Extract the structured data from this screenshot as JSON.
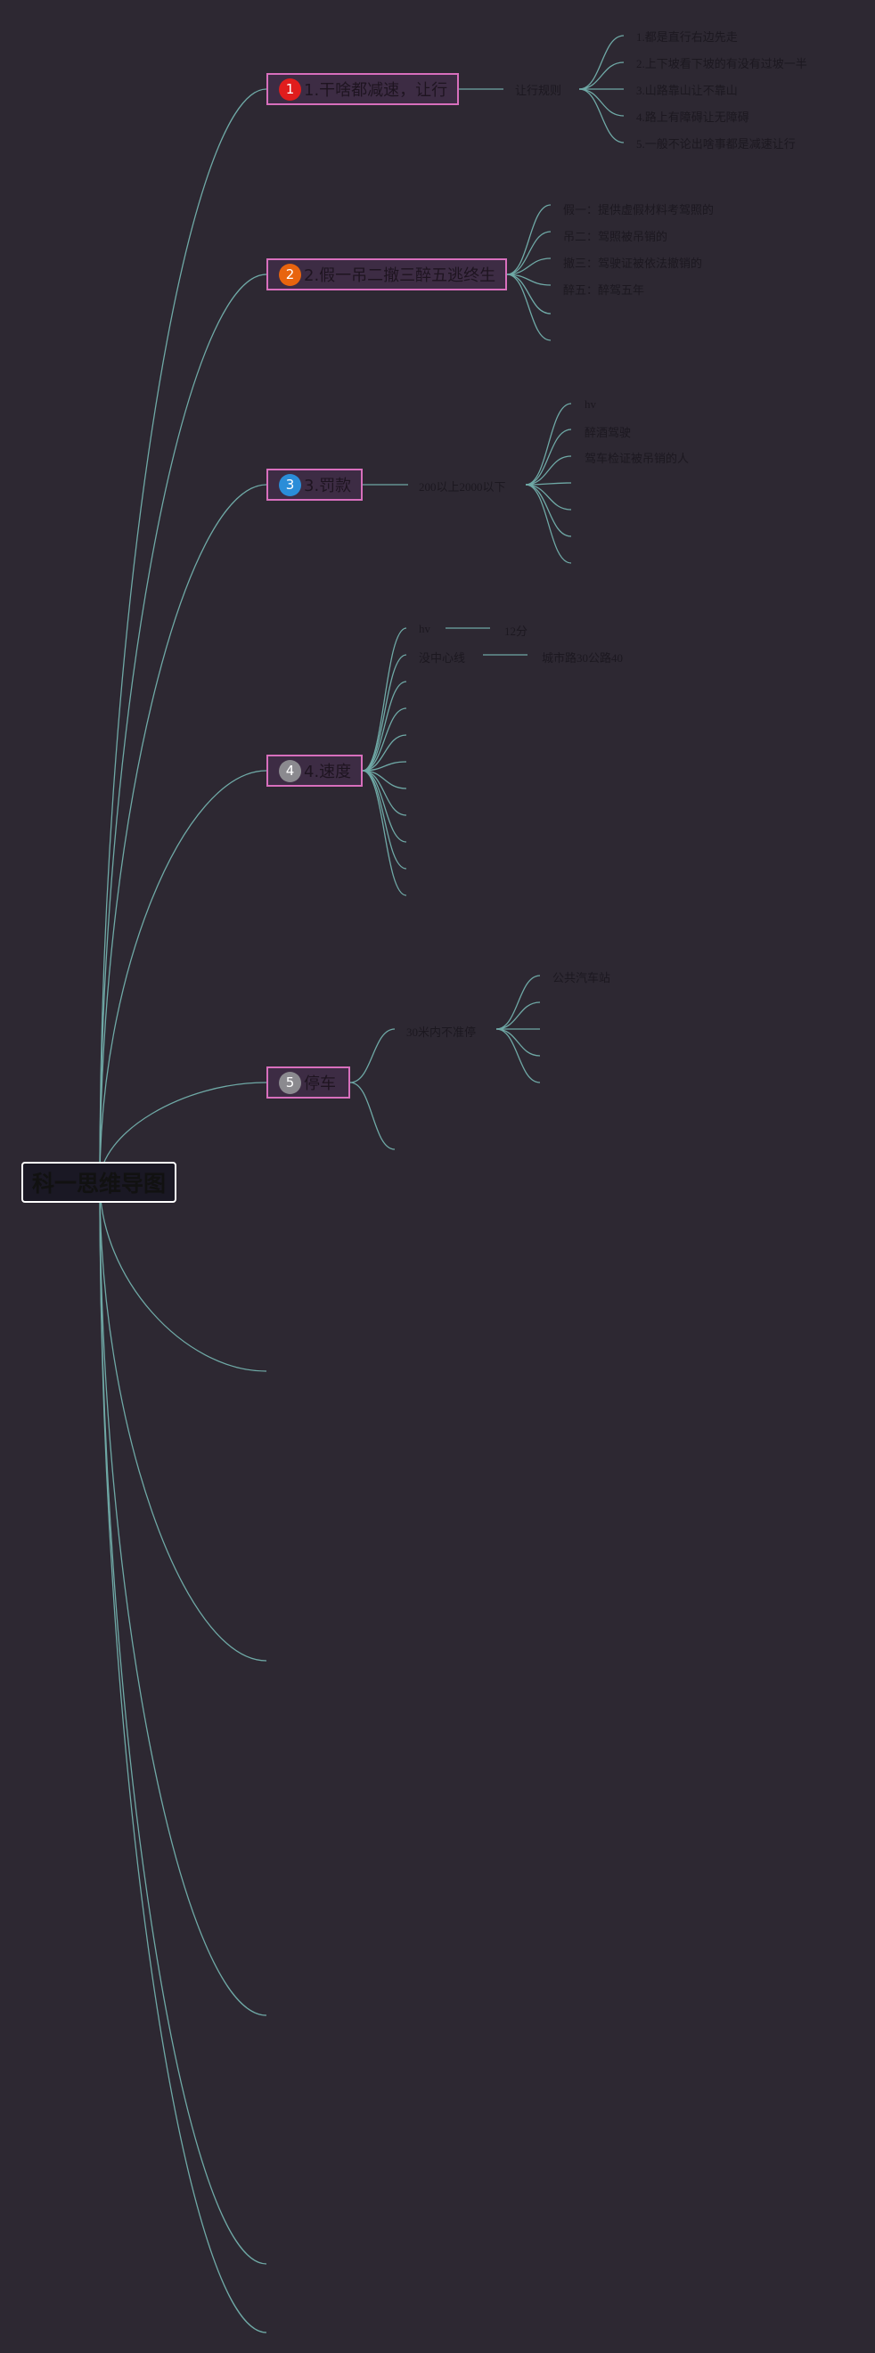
{
  "root": {
    "title": "科一思维导图"
  },
  "colors": {
    "background": "#2d2832",
    "link": "#6fa9a6",
    "branch_border": "#d86fbd",
    "badge_1": "#e01d1d",
    "badge_2": "#e8640e",
    "badge_3": "#2a8dd8",
    "badge_4": "#8b8a8f",
    "badge_5": "#8b8a8f"
  },
  "branches": [
    {
      "badge": "1",
      "label": "1.干啥都减速，让行",
      "sub": "让行规则",
      "leaves": [
        "1.都是直行右边先走",
        "2.上下坡看下坡的有没有过坡一半",
        "3.山路靠山让不靠山",
        "4.路上有障碍让无障碍",
        "5.一般不论出啥事都是减速让行"
      ]
    },
    {
      "badge": "2",
      "label": "2.假一吊二撤三醉五逃终生",
      "leaves": [
        "假一：提供虚假材料考驾照的",
        "吊二：驾照被吊销的",
        "撤三：驾驶证被依法撤销的",
        "醉五：醉驾五年"
      ]
    },
    {
      "badge": "3",
      "label": "3.罚款",
      "sub": "200以上2000以下",
      "leaves": [
        "hv",
        "醉酒驾驶",
        "驾车检证被吊销的人"
      ]
    },
    {
      "badge": "4",
      "label": "4.速度",
      "rows": [
        {
          "key": "hv",
          "value": "12分"
        },
        {
          "key": "没中心线",
          "value": "城市路30公路40"
        }
      ]
    },
    {
      "badge": "5",
      "label": "停车",
      "sub": "30米内不准停",
      "leaves": [
        "公共汽车站"
      ]
    }
  ]
}
